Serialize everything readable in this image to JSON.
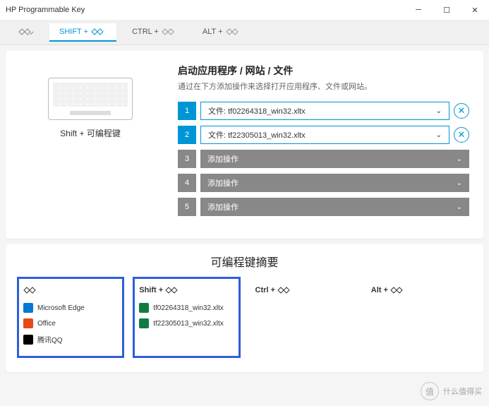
{
  "window": {
    "title": "HP Programmable Key"
  },
  "tabs": {
    "shift": "SHIFT + ",
    "ctrl": "CTRL + ",
    "alt": "ALT + "
  },
  "left": {
    "label": "Shift + 可编程键"
  },
  "launch": {
    "title": "启动应用程序 / 网站 / 文件",
    "desc": "通过在下方添加操作来选择打开应用程序、文件或网站。",
    "rows": [
      {
        "n": "1",
        "label": "文件: tf02264318_win32.xltx",
        "filled": true
      },
      {
        "n": "2",
        "label": "文件: tf22305013_win32.xltx",
        "filled": true
      },
      {
        "n": "3",
        "label": "添加操作",
        "filled": false
      },
      {
        "n": "4",
        "label": "添加操作",
        "filled": false
      },
      {
        "n": "5",
        "label": "添加操作",
        "filled": false
      }
    ]
  },
  "summary": {
    "title": "可编程键摘要",
    "cols": [
      {
        "head": "",
        "hl": true,
        "items": [
          {
            "label": "Microsoft Edge",
            "color": "#0078d4"
          },
          {
            "label": "Office",
            "color": "#e64a19"
          },
          {
            "label": "腾讯QQ",
            "color": "#000"
          }
        ]
      },
      {
        "head": "Shift + ",
        "hl": true,
        "items": [
          {
            "label": "tf02264318_win32.xltx",
            "color": "#107c41"
          },
          {
            "label": "tf22305013_win32.xltx",
            "color": "#107c41"
          }
        ]
      },
      {
        "head": "Ctrl + ",
        "hl": false,
        "items": []
      },
      {
        "head": "Alt + ",
        "hl": false,
        "items": []
      }
    ]
  },
  "watermark": {
    "badge": "值",
    "text": "什么值得买"
  }
}
